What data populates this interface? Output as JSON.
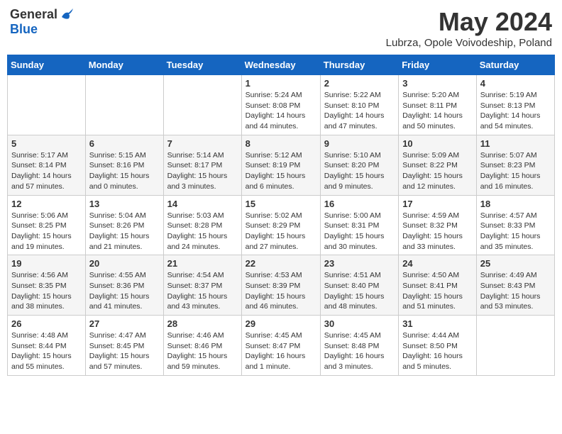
{
  "header": {
    "logo_general": "General",
    "logo_blue": "Blue",
    "month_title": "May 2024",
    "subtitle": "Lubrza, Opole Voivodeship, Poland"
  },
  "days_of_week": [
    "Sunday",
    "Monday",
    "Tuesday",
    "Wednesday",
    "Thursday",
    "Friday",
    "Saturday"
  ],
  "weeks": [
    [
      {
        "day": "",
        "info": ""
      },
      {
        "day": "",
        "info": ""
      },
      {
        "day": "",
        "info": ""
      },
      {
        "day": "1",
        "info": "Sunrise: 5:24 AM\nSunset: 8:08 PM\nDaylight: 14 hours and 44 minutes."
      },
      {
        "day": "2",
        "info": "Sunrise: 5:22 AM\nSunset: 8:10 PM\nDaylight: 14 hours and 47 minutes."
      },
      {
        "day": "3",
        "info": "Sunrise: 5:20 AM\nSunset: 8:11 PM\nDaylight: 14 hours and 50 minutes."
      },
      {
        "day": "4",
        "info": "Sunrise: 5:19 AM\nSunset: 8:13 PM\nDaylight: 14 hours and 54 minutes."
      }
    ],
    [
      {
        "day": "5",
        "info": "Sunrise: 5:17 AM\nSunset: 8:14 PM\nDaylight: 14 hours and 57 minutes."
      },
      {
        "day": "6",
        "info": "Sunrise: 5:15 AM\nSunset: 8:16 PM\nDaylight: 15 hours and 0 minutes."
      },
      {
        "day": "7",
        "info": "Sunrise: 5:14 AM\nSunset: 8:17 PM\nDaylight: 15 hours and 3 minutes."
      },
      {
        "day": "8",
        "info": "Sunrise: 5:12 AM\nSunset: 8:19 PM\nDaylight: 15 hours and 6 minutes."
      },
      {
        "day": "9",
        "info": "Sunrise: 5:10 AM\nSunset: 8:20 PM\nDaylight: 15 hours and 9 minutes."
      },
      {
        "day": "10",
        "info": "Sunrise: 5:09 AM\nSunset: 8:22 PM\nDaylight: 15 hours and 12 minutes."
      },
      {
        "day": "11",
        "info": "Sunrise: 5:07 AM\nSunset: 8:23 PM\nDaylight: 15 hours and 16 minutes."
      }
    ],
    [
      {
        "day": "12",
        "info": "Sunrise: 5:06 AM\nSunset: 8:25 PM\nDaylight: 15 hours and 19 minutes."
      },
      {
        "day": "13",
        "info": "Sunrise: 5:04 AM\nSunset: 8:26 PM\nDaylight: 15 hours and 21 minutes."
      },
      {
        "day": "14",
        "info": "Sunrise: 5:03 AM\nSunset: 8:28 PM\nDaylight: 15 hours and 24 minutes."
      },
      {
        "day": "15",
        "info": "Sunrise: 5:02 AM\nSunset: 8:29 PM\nDaylight: 15 hours and 27 minutes."
      },
      {
        "day": "16",
        "info": "Sunrise: 5:00 AM\nSunset: 8:31 PM\nDaylight: 15 hours and 30 minutes."
      },
      {
        "day": "17",
        "info": "Sunrise: 4:59 AM\nSunset: 8:32 PM\nDaylight: 15 hours and 33 minutes."
      },
      {
        "day": "18",
        "info": "Sunrise: 4:57 AM\nSunset: 8:33 PM\nDaylight: 15 hours and 35 minutes."
      }
    ],
    [
      {
        "day": "19",
        "info": "Sunrise: 4:56 AM\nSunset: 8:35 PM\nDaylight: 15 hours and 38 minutes."
      },
      {
        "day": "20",
        "info": "Sunrise: 4:55 AM\nSunset: 8:36 PM\nDaylight: 15 hours and 41 minutes."
      },
      {
        "day": "21",
        "info": "Sunrise: 4:54 AM\nSunset: 8:37 PM\nDaylight: 15 hours and 43 minutes."
      },
      {
        "day": "22",
        "info": "Sunrise: 4:53 AM\nSunset: 8:39 PM\nDaylight: 15 hours and 46 minutes."
      },
      {
        "day": "23",
        "info": "Sunrise: 4:51 AM\nSunset: 8:40 PM\nDaylight: 15 hours and 48 minutes."
      },
      {
        "day": "24",
        "info": "Sunrise: 4:50 AM\nSunset: 8:41 PM\nDaylight: 15 hours and 51 minutes."
      },
      {
        "day": "25",
        "info": "Sunrise: 4:49 AM\nSunset: 8:43 PM\nDaylight: 15 hours and 53 minutes."
      }
    ],
    [
      {
        "day": "26",
        "info": "Sunrise: 4:48 AM\nSunset: 8:44 PM\nDaylight: 15 hours and 55 minutes."
      },
      {
        "day": "27",
        "info": "Sunrise: 4:47 AM\nSunset: 8:45 PM\nDaylight: 15 hours and 57 minutes."
      },
      {
        "day": "28",
        "info": "Sunrise: 4:46 AM\nSunset: 8:46 PM\nDaylight: 15 hours and 59 minutes."
      },
      {
        "day": "29",
        "info": "Sunrise: 4:45 AM\nSunset: 8:47 PM\nDaylight: 16 hours and 1 minute."
      },
      {
        "day": "30",
        "info": "Sunrise: 4:45 AM\nSunset: 8:48 PM\nDaylight: 16 hours and 3 minutes."
      },
      {
        "day": "31",
        "info": "Sunrise: 4:44 AM\nSunset: 8:50 PM\nDaylight: 16 hours and 5 minutes."
      },
      {
        "day": "",
        "info": ""
      }
    ]
  ]
}
